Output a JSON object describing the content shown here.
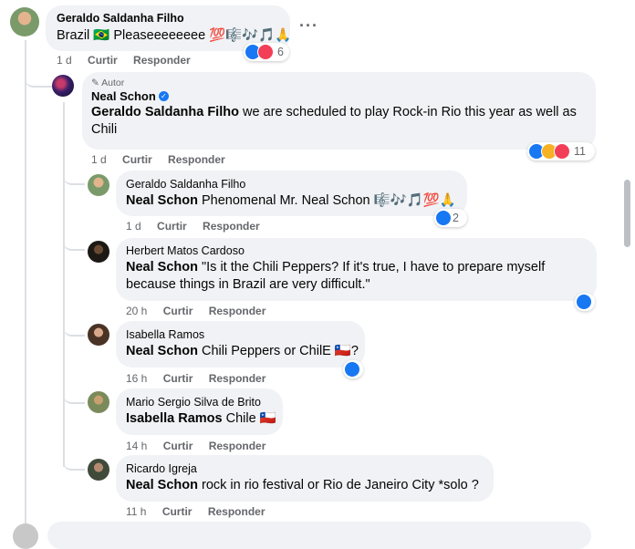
{
  "comments": {
    "c1": {
      "author": "Geraldo Saldanha Filho",
      "text": "Brazil 🇧🇷 Pleaseeeeeeee 💯🎼🎶🎵🙏",
      "time": "1 d",
      "reaction_count": "6"
    },
    "c2": {
      "badge": "Autor",
      "author": "Neal Schon",
      "mention": "Geraldo Saldanha Filho",
      "text": " we are scheduled to play Rock-in Rio this year as well as Chili",
      "time": "1 d",
      "reaction_count": "11"
    },
    "c3": {
      "author": "Geraldo Saldanha Filho",
      "mention": "Neal Schon",
      "text": " Phenomenal Mr. Neal Schon 🎼🎶🎵💯🙏",
      "time": "1 d",
      "reaction_count": "2"
    },
    "c4": {
      "author": "Herbert Matos Cardoso",
      "mention": "Neal Schon",
      "text": " \"Is it the Chili Peppers? If it's true, I have to prepare myself because things in Brazil are very difficult.\"",
      "time": "20 h"
    },
    "c5": {
      "author": "Isabella Ramos",
      "mention": "Neal Schon",
      "text": " Chili Peppers or ChilE 🇨🇱?",
      "time": "16 h"
    },
    "c6": {
      "author": "Mario Sergio Silva de Brito",
      "mention": "Isabella Ramos",
      "text": " Chile 🇨🇱",
      "time": "14 h"
    },
    "c7": {
      "author": "Ricardo Igreja",
      "mention": "Neal Schon",
      "text": " rock in rio festival or Rio de Janeiro City *solo ?",
      "time": "11 h"
    }
  },
  "actions": {
    "like": "Curtir",
    "reply": "Responder"
  },
  "more_glyph": "···",
  "colors": {
    "like": "#1877f2",
    "love": "#f33e58",
    "wow": "#f7b125",
    "bubble": "#f0f2f5",
    "meta": "#65676b"
  },
  "icons": [
    "like-icon",
    "love-icon",
    "wow-icon",
    "verified-icon",
    "pencil-icon",
    "more-icon"
  ]
}
